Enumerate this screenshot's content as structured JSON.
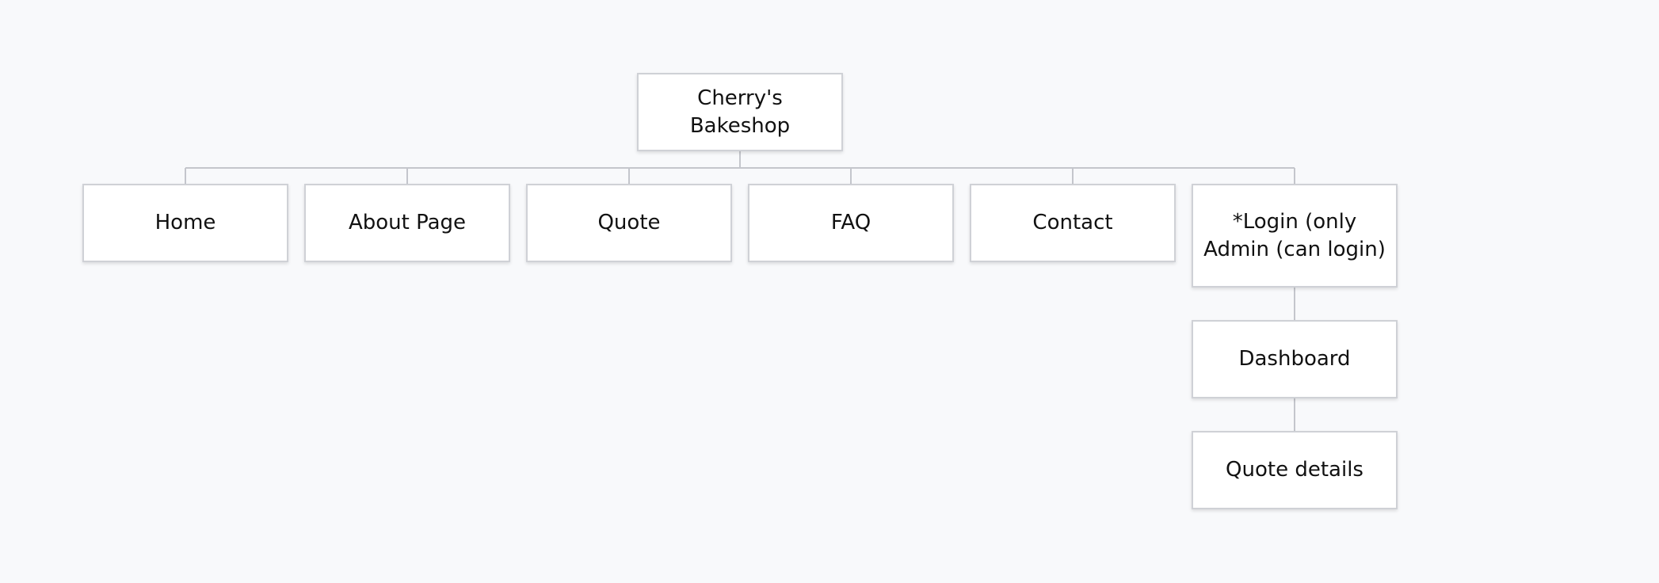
{
  "root": {
    "label": "Cherry's Bakeshop"
  },
  "children": [
    {
      "label": "Home"
    },
    {
      "label": "About Page"
    },
    {
      "label": "Quote"
    },
    {
      "label": "FAQ"
    },
    {
      "label": "Contact"
    },
    {
      "label": "*Login (only Admin (can login)",
      "children": [
        {
          "label": "Dashboard",
          "children": [
            {
              "label": "Quote details"
            }
          ]
        }
      ]
    }
  ]
}
